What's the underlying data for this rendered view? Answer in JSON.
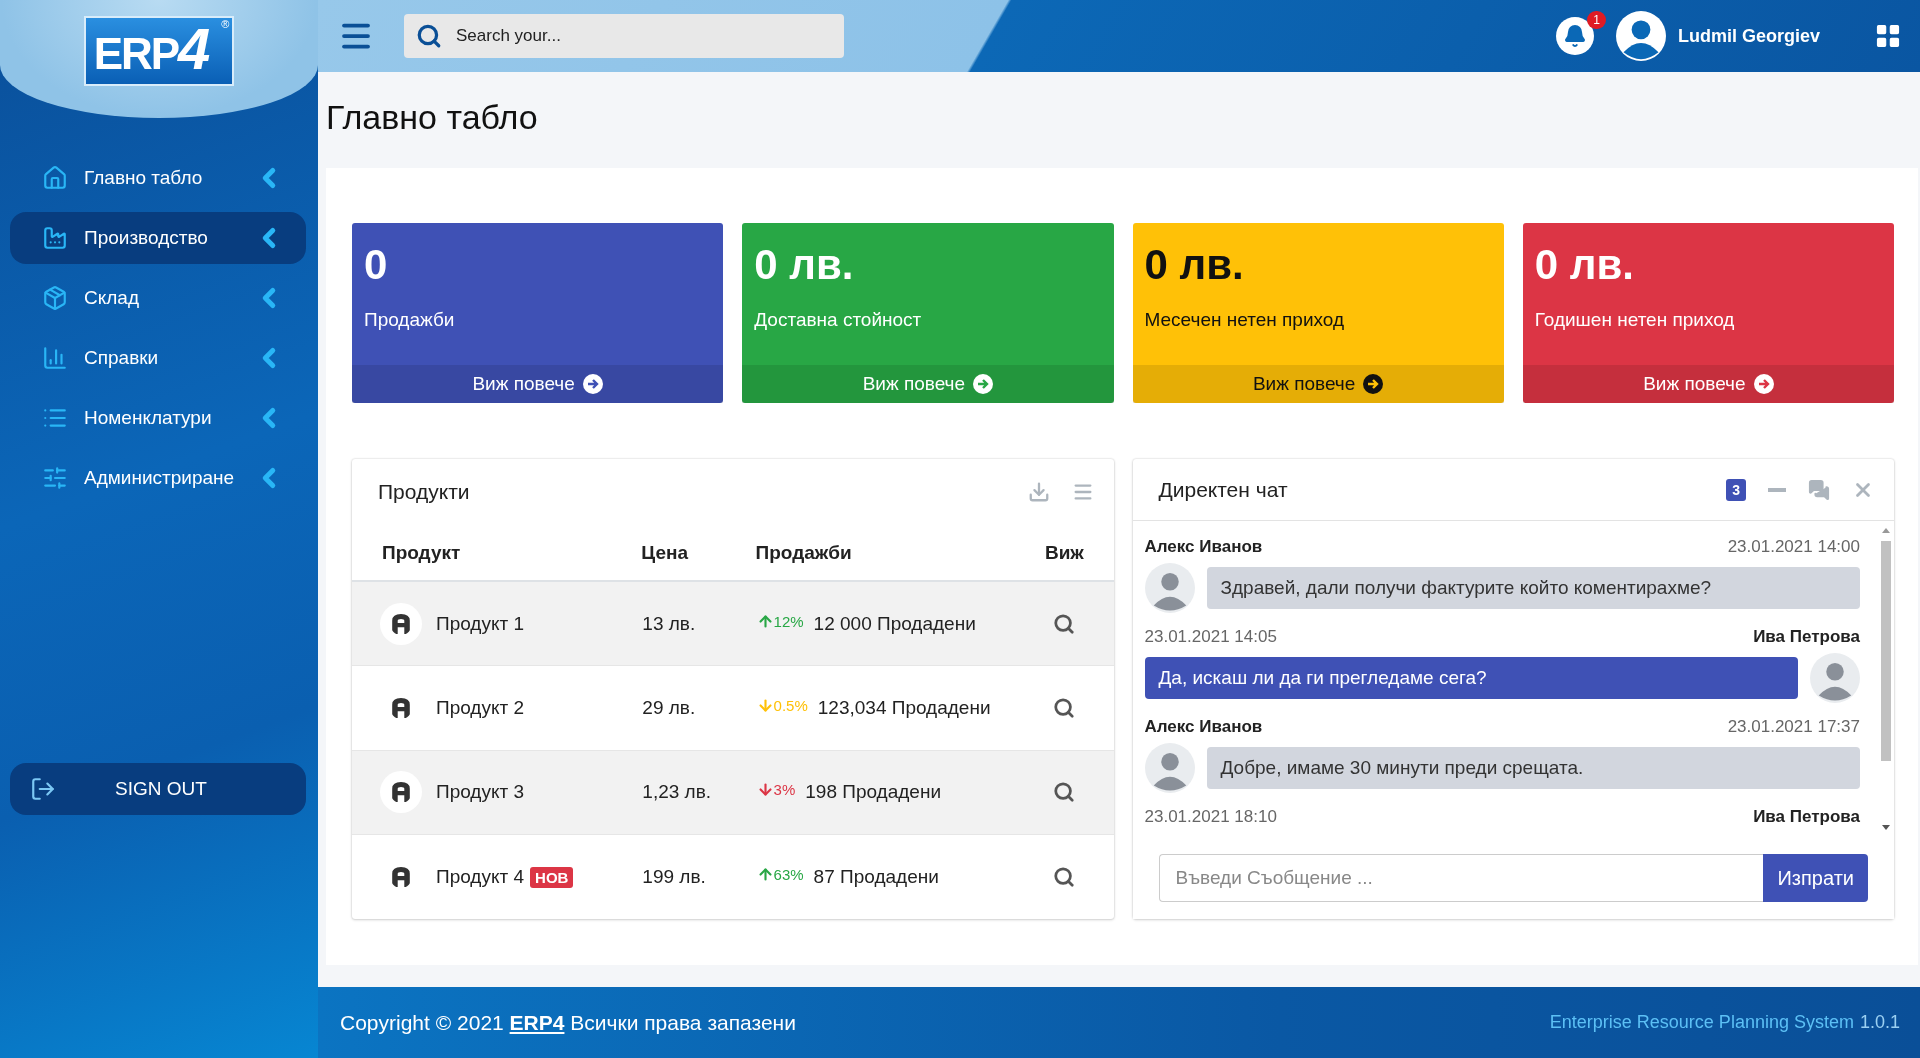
{
  "logo": {
    "text": "ERP",
    "digit": "4",
    "mark": "®"
  },
  "sidebar": {
    "items": [
      {
        "label": "Главно табло",
        "selected": false
      },
      {
        "label": "Производство",
        "selected": true
      },
      {
        "label": "Склад",
        "selected": false
      },
      {
        "label": "Справки",
        "selected": false
      },
      {
        "label": "Номенклатури",
        "selected": false
      },
      {
        "label": "Администриране",
        "selected": false
      }
    ],
    "sign_out": "SIGN OUT"
  },
  "header": {
    "search": {
      "placeholder": "Search your..."
    },
    "notifications": "1",
    "user": "Ludmil Georgiev"
  },
  "page_title": "Главно табло",
  "stats": [
    {
      "value": "0",
      "label": "Продажби",
      "link": "Виж повече",
      "color": "#3f51b5"
    },
    {
      "value": "0 лв.",
      "label": "Доставна стойност",
      "link": "Виж повече",
      "color": "#28a745"
    },
    {
      "value": "0 лв.",
      "label": "Месечен нетен приход",
      "link": "Виж повече",
      "color": "#ffc107"
    },
    {
      "value": "0 лв.",
      "label": "Годишен нетен приход",
      "link": "Виж повече",
      "color": "#dc3545"
    }
  ],
  "products": {
    "title": "Продукти",
    "columns": [
      "Продукт",
      "Цена",
      "Продажби",
      "Виж"
    ],
    "rows": [
      {
        "name": "Продукт 1",
        "price": "13 лв.",
        "trend": {
          "kind": "up",
          "percent": "12%",
          "color": "#28a745"
        },
        "sold": "12 000 Продадени"
      },
      {
        "name": "Продукт 2",
        "price": "29 лв.",
        "trend": {
          "kind": "down",
          "percent": "0.5%",
          "color": "#ffc107"
        },
        "sold": "123,034 Продадени"
      },
      {
        "name": "Продукт 3",
        "price": "1,23 лв.",
        "trend": {
          "kind": "down",
          "percent": "3%",
          "color": "#dc3545"
        },
        "sold": "198 Продадени"
      },
      {
        "name": "Продукт 4",
        "badge": "НОВ",
        "price": "199 лв.",
        "trend": {
          "kind": "up",
          "percent": "63%",
          "color": "#28a745"
        },
        "sold": "87 Продадени"
      }
    ]
  },
  "chat": {
    "title": "Директен чат",
    "count": "3",
    "messages": [
      {
        "kind": "received",
        "name": "Алекс Иванов",
        "time": "23.01.2021 14:00",
        "text": "Здравей, дали получи фактурите който коментирахме?"
      },
      {
        "kind": "sent",
        "name": "Ива Петрова",
        "time": "23.01.2021 14:05",
        "text": "Да, искаш ли да ги прегледаме сега?"
      },
      {
        "kind": "received",
        "name": "Алекс Иванов",
        "time": "23.01.2021 17:37",
        "text": "Добре, имаме 30 минути преди срещата."
      },
      {
        "kind": "sent",
        "name": "Ива Петрова",
        "time": "23.01.2021 18:10"
      }
    ],
    "input": {
      "placeholder": "Въведи Съобщение ..."
    },
    "send": "Изпрати"
  },
  "footer": {
    "before": "Copyright © 2021",
    "link": "ERP4",
    "after": "Всички права запазени",
    "system": "Enterprise Resource Planning System",
    "version": "1.0.1"
  }
}
